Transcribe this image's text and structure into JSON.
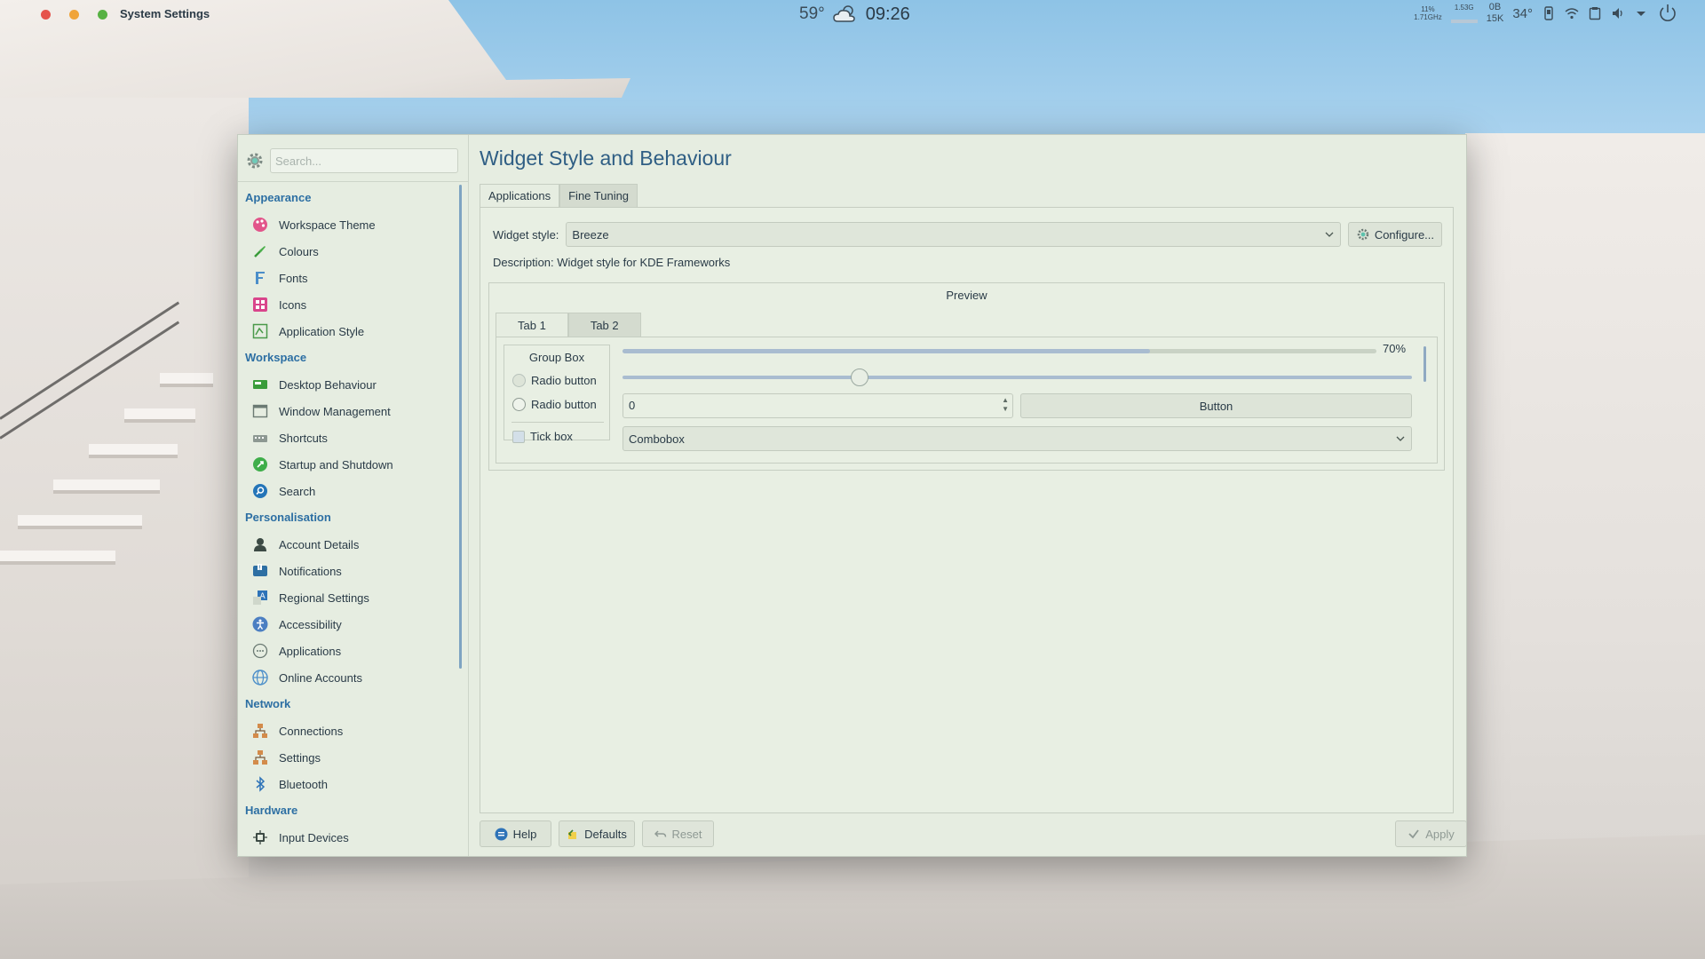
{
  "topbar": {
    "app_title": "System Settings",
    "temperature": "59°",
    "time": "09:26",
    "weather_icon": "partly-cloudy-icon",
    "tray": {
      "cpu_top": "11%",
      "cpu_bottom": "1.71GHz",
      "mem_top": "1.53G",
      "net_top": "0B",
      "net_bottom": "15K",
      "cpu_temp": "34°"
    },
    "colors": {
      "close": "#e5534b",
      "minimize": "#f0a43a",
      "maximize": "#57b143"
    }
  },
  "sidebar": {
    "search_placeholder": "Search...",
    "categories": [
      {
        "label": "Appearance",
        "items": [
          {
            "label": "Workspace Theme",
            "icon": "palette-icon"
          },
          {
            "label": "Colours",
            "icon": "colours-icon"
          },
          {
            "label": "Fonts",
            "icon": "fonts-icon"
          },
          {
            "label": "Icons",
            "icon": "icons-icon"
          },
          {
            "label": "Application Style",
            "icon": "application-style-icon"
          }
        ]
      },
      {
        "label": "Workspace",
        "items": [
          {
            "label": "Desktop Behaviour",
            "icon": "desktop-behaviour-icon"
          },
          {
            "label": "Window Management",
            "icon": "window-management-icon"
          },
          {
            "label": "Shortcuts",
            "icon": "shortcuts-icon"
          },
          {
            "label": "Startup and Shutdown",
            "icon": "startup-icon"
          },
          {
            "label": "Search",
            "icon": "search-icon"
          }
        ]
      },
      {
        "label": "Personalisation",
        "items": [
          {
            "label": "Account Details",
            "icon": "account-icon"
          },
          {
            "label": "Notifications",
            "icon": "notifications-icon"
          },
          {
            "label": "Regional Settings",
            "icon": "regional-icon"
          },
          {
            "label": "Accessibility",
            "icon": "accessibility-icon"
          },
          {
            "label": "Applications",
            "icon": "applications-icon"
          },
          {
            "label": "Online Accounts",
            "icon": "online-accounts-icon"
          }
        ]
      },
      {
        "label": "Network",
        "items": [
          {
            "label": "Connections",
            "icon": "connections-icon"
          },
          {
            "label": "Settings",
            "icon": "network-settings-icon"
          },
          {
            "label": "Bluetooth",
            "icon": "bluetooth-icon"
          }
        ]
      },
      {
        "label": "Hardware",
        "items": [
          {
            "label": "Input Devices",
            "icon": "input-devices-icon"
          }
        ]
      }
    ]
  },
  "main": {
    "title": "Widget Style and Behaviour",
    "tabs": [
      {
        "label": "Applications"
      },
      {
        "label": "Fine Tuning"
      }
    ],
    "widget_style_label": "Widget style:",
    "widget_style_value": "Breeze",
    "configure_label": "Configure...",
    "description": "Description: Widget style for KDE Frameworks",
    "preview": {
      "title": "Preview",
      "tabs": [
        {
          "label": "Tab 1"
        },
        {
          "label": "Tab 2"
        }
      ],
      "group_box_title": "Group Box",
      "radio_1": "Radio button",
      "radio_2": "Radio button",
      "tick_box": "Tick box",
      "progress_value": 0.7,
      "progress_text": "70%",
      "slider_value": 0.3,
      "spinbox_value": "0",
      "button_label": "Button",
      "combobox_value": "Combobox"
    }
  },
  "footer": {
    "help": "Help",
    "defaults": "Defaults",
    "reset": "Reset",
    "apply": "Apply"
  }
}
